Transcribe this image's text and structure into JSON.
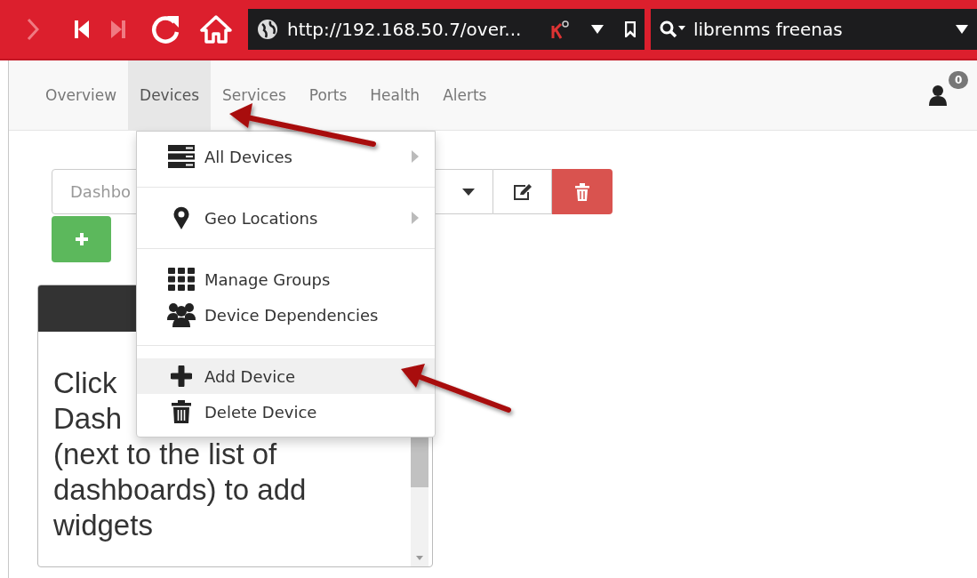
{
  "browser": {
    "url": "http://192.168.50.7/over...",
    "search": "librenms freenas"
  },
  "nav": {
    "items": [
      {
        "label": "Overview",
        "selected": false
      },
      {
        "label": "Devices",
        "selected": true
      },
      {
        "label": "Services",
        "selected": false
      },
      {
        "label": "Ports",
        "selected": false
      },
      {
        "label": "Health",
        "selected": false
      },
      {
        "label": "Alerts",
        "selected": false
      }
    ],
    "notifications": "0"
  },
  "dashboard": {
    "select": "Dashbo"
  },
  "widget": {
    "lines": [
      "Click",
      "Dash",
      "(next to the list of",
      "dashboards) to add",
      "widgets"
    ]
  },
  "menu": {
    "groups": [
      [
        {
          "label": "All Devices",
          "submenu": true,
          "selected": false
        }
      ],
      [
        {
          "label": "Geo Locations",
          "submenu": true,
          "selected": false
        }
      ],
      [
        {
          "label": "Manage Groups",
          "submenu": false,
          "selected": false
        },
        {
          "label": "Device Dependencies",
          "submenu": false,
          "selected": false
        }
      ],
      [
        {
          "label": "Add Device",
          "submenu": false,
          "selected": true
        },
        {
          "label": "Delete Device",
          "submenu": false,
          "selected": false
        }
      ]
    ]
  }
}
